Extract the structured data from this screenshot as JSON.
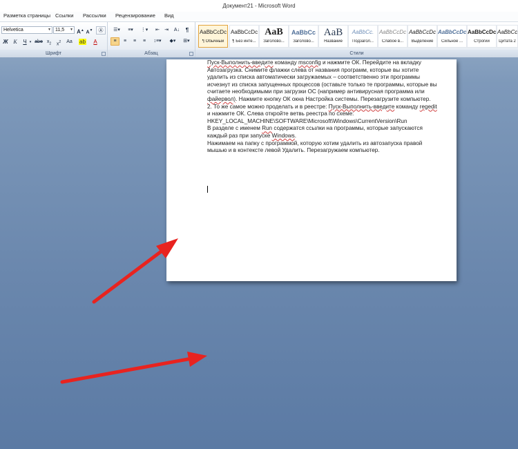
{
  "window": {
    "title": "Документ21 - Microsoft Word"
  },
  "tabs": [
    "Разметка страницы",
    "Ссылки",
    "Рассылки",
    "Рецензирование",
    "Вид"
  ],
  "ribbon": {
    "font_group_label": "Шрифт",
    "paragraph_group_label": "Абзац",
    "styles_group_label": "Стили",
    "font_name": "Helvetica",
    "font_size": "11,5",
    "styles": [
      {
        "sample": "AaBbCcDc",
        "name": "¶ Обычный",
        "selected": true
      },
      {
        "sample": "AaBbCcDc",
        "name": "¶ Без инте...",
        "selected": false
      },
      {
        "sample": "AaB",
        "name": "Заголово...",
        "selected": false
      },
      {
        "sample": "AaBbCc",
        "name": "Заголово...",
        "selected": false
      },
      {
        "sample": "AaB",
        "name": "Название",
        "selected": false
      },
      {
        "sample": "AaBbCc.",
        "name": "Подзагол...",
        "selected": false
      },
      {
        "sample": "AaBbCcDc",
        "name": "Слабое в...",
        "selected": false
      },
      {
        "sample": "AaBbCcDc",
        "name": "Выделение",
        "selected": false
      },
      {
        "sample": "AaBbCcDc",
        "name": "Сильное ...",
        "selected": false
      },
      {
        "sample": "AaBbCcDc",
        "name": "Строгий",
        "selected": false
      },
      {
        "sample": "AaBbCcDc",
        "name": "Цитата 2",
        "selected": false
      }
    ]
  },
  "document": {
    "p1": {
      "a": "Пуск-Выполнить-введите",
      "b": " команду ",
      "c": "msconfig",
      "d": " и нажмите ОК. Перейдите на вкладку Автозагрузка. Снимите флажки слева от названия программ, которые вы хотите удалить из списка автоматически загружаемых – соответственно эти программы исчезнут из списка запущенных процессов (оставьте только те программы, которые вы считаете необходимыми при загрузки ОС (например антивирусная программа или ",
      "e": "файервол)",
      "f": ". Нажмите кнопку ОК окна Настройка системы. Перезагрузите компьютер."
    },
    "p2": {
      "a": "2. То же самое можно проделать и в реестре: ",
      "b": "Пуск-Выполнить-введите",
      "c": " команду ",
      "d": "regedit",
      "e": " и нажмите ОК. Слева откройте ветвь реестра по схеме:"
    },
    "p3": "HKEY_LOCAL_MACHINE\\SOFTWARE\\Microsoft\\Windows\\CurrentVersion\\Run",
    "p4": {
      "a": "В разделе с именем ",
      "b": "Run",
      "c": " содержатся ссылки на программы, которые запускаются каждый раз при запуске ",
      "d": "Windows",
      "e": "."
    },
    "p5": "Нажимаем на папку с программой, которую хотим удалить из автозапуска правой мышью и в контексте левой Удалить. Перезагружаем компьютер."
  },
  "colors": {
    "arrow": "#e8231f",
    "background_top": "#9fb4cc",
    "background_bottom": "#5b7aa4",
    "selected_style": "#e2a33d"
  }
}
